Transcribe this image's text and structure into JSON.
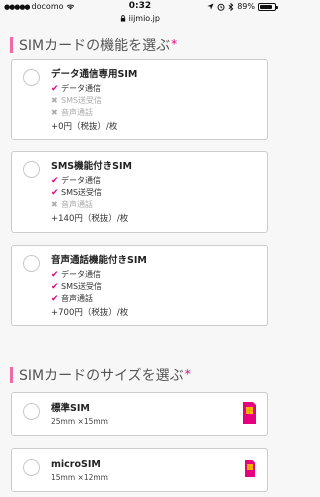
{
  "status_bar": {
    "carrier": "docomo",
    "time": "0:32",
    "battery": "89%",
    "battery_level": 0.89
  },
  "url_bar": {
    "domain": "iijmio.jp"
  },
  "function_section": {
    "title": "SIMカードの機能を選ぶ",
    "required_mark": "*",
    "options": [
      {
        "name": "データ通信専用SIM",
        "features": [
          {
            "label": "データ通信",
            "included": true
          },
          {
            "label": "SMS送受信",
            "included": false
          },
          {
            "label": "音声通話",
            "included": false
          }
        ],
        "price": "+0円（税抜）/枚"
      },
      {
        "name": "SMS機能付きSIM",
        "features": [
          {
            "label": "データ通信",
            "included": true
          },
          {
            "label": "SMS送受信",
            "included": true
          },
          {
            "label": "音声通話",
            "included": false
          }
        ],
        "price": "+140円（税抜）/枚"
      },
      {
        "name": "音声通話機能付きSIM",
        "features": [
          {
            "label": "データ通信",
            "included": true
          },
          {
            "label": "SMS送受信",
            "included": true
          },
          {
            "label": "音声通話",
            "included": true
          }
        ],
        "price": "+700円（税抜）/枚"
      }
    ]
  },
  "size_section": {
    "title": "SIMカードのサイズを選ぶ",
    "required_mark": "*",
    "options": [
      {
        "name": "標準SIM",
        "dimensions": "25mm ×15mm"
      },
      {
        "name": "microSIM",
        "dimensions": "15mm ×12mm"
      }
    ]
  },
  "colors": {
    "accent": "#e4007f",
    "section_bar": "#ee6aa7",
    "sim_chip": "#f7b500",
    "sim_body": "#e4007f"
  }
}
